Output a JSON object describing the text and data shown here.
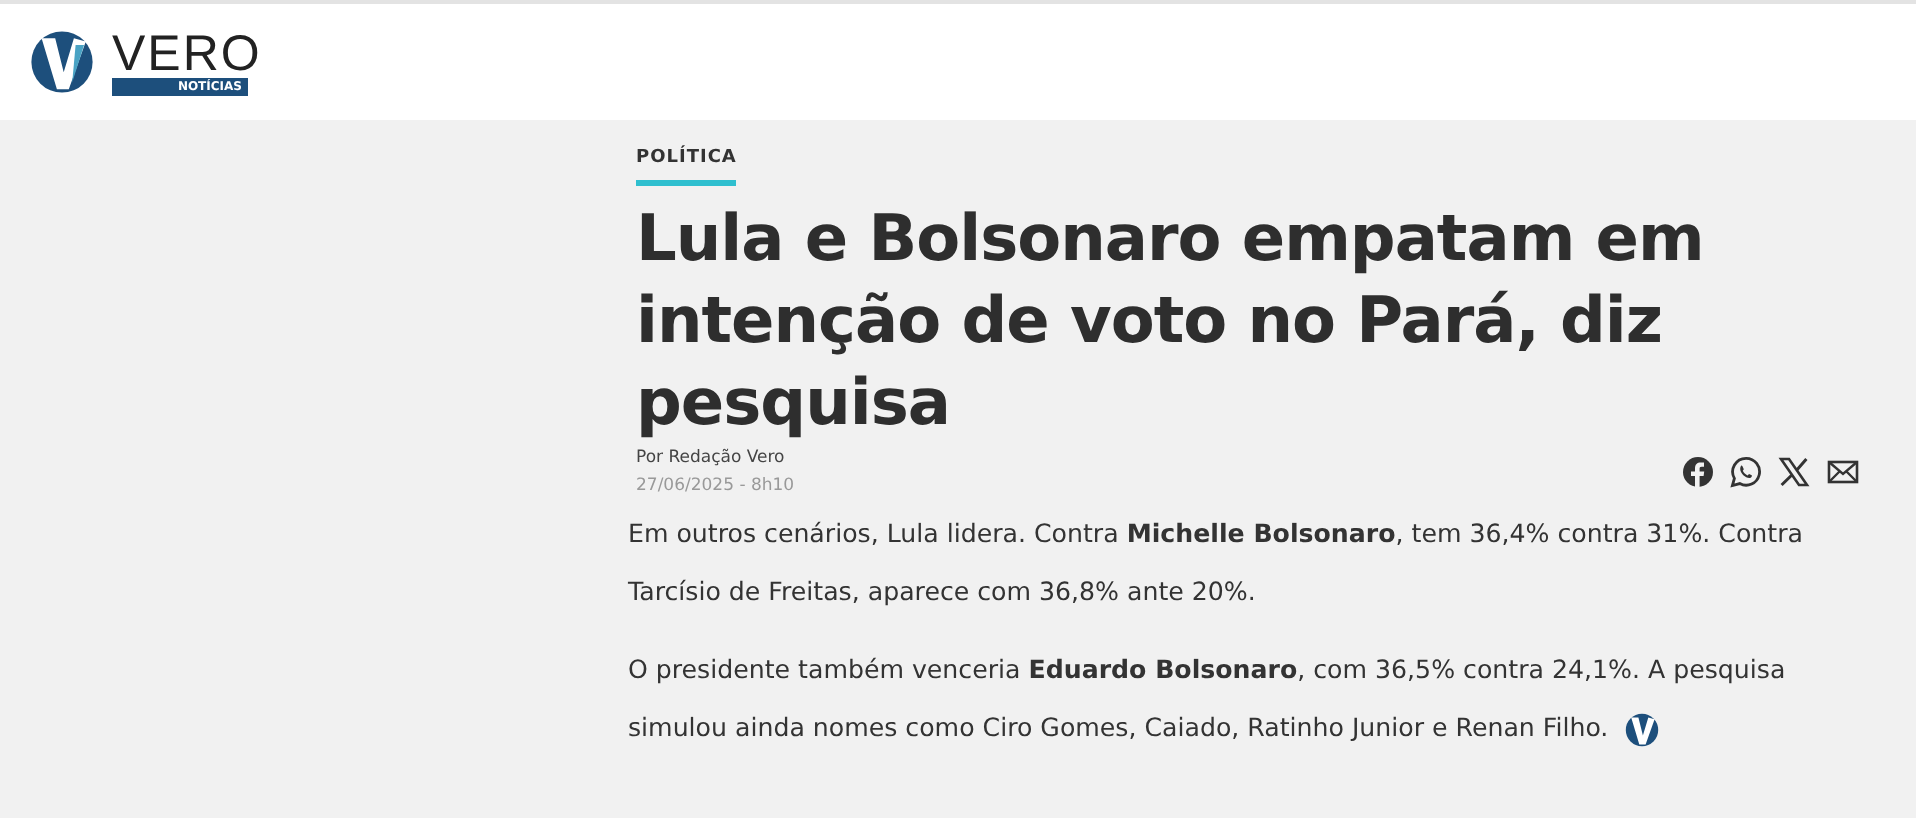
{
  "header": {
    "logo": {
      "name": "VERO",
      "tagline": "NOTÍCIAS"
    }
  },
  "article": {
    "category": "POLÍTICA",
    "title": "Lula e Bolsonaro empatam em intenção de voto no Pará, diz pesquisa",
    "byline": "Por Redação Vero",
    "date": "27/06/2025 - 8h10",
    "share": [
      {
        "kind": "facebook"
      },
      {
        "kind": "whatsapp"
      },
      {
        "kind": "x"
      },
      {
        "kind": "email"
      }
    ],
    "paragraphs": [
      "Em outros cenários, Lula lidera. Contra **Michelle Bolsonaro**, tem 36,4% contra 31%. Contra Tarcísio de Freitas, aparece com 36,8% ante 20%.",
      "O presidente também venceria **Eduardo Bolsonaro**, com 36,5% contra 24,1%. A pesquisa simulou ainda nomes como Ciro Gomes, Caiado, Ratinho Junior e Renan Filho."
    ]
  }
}
